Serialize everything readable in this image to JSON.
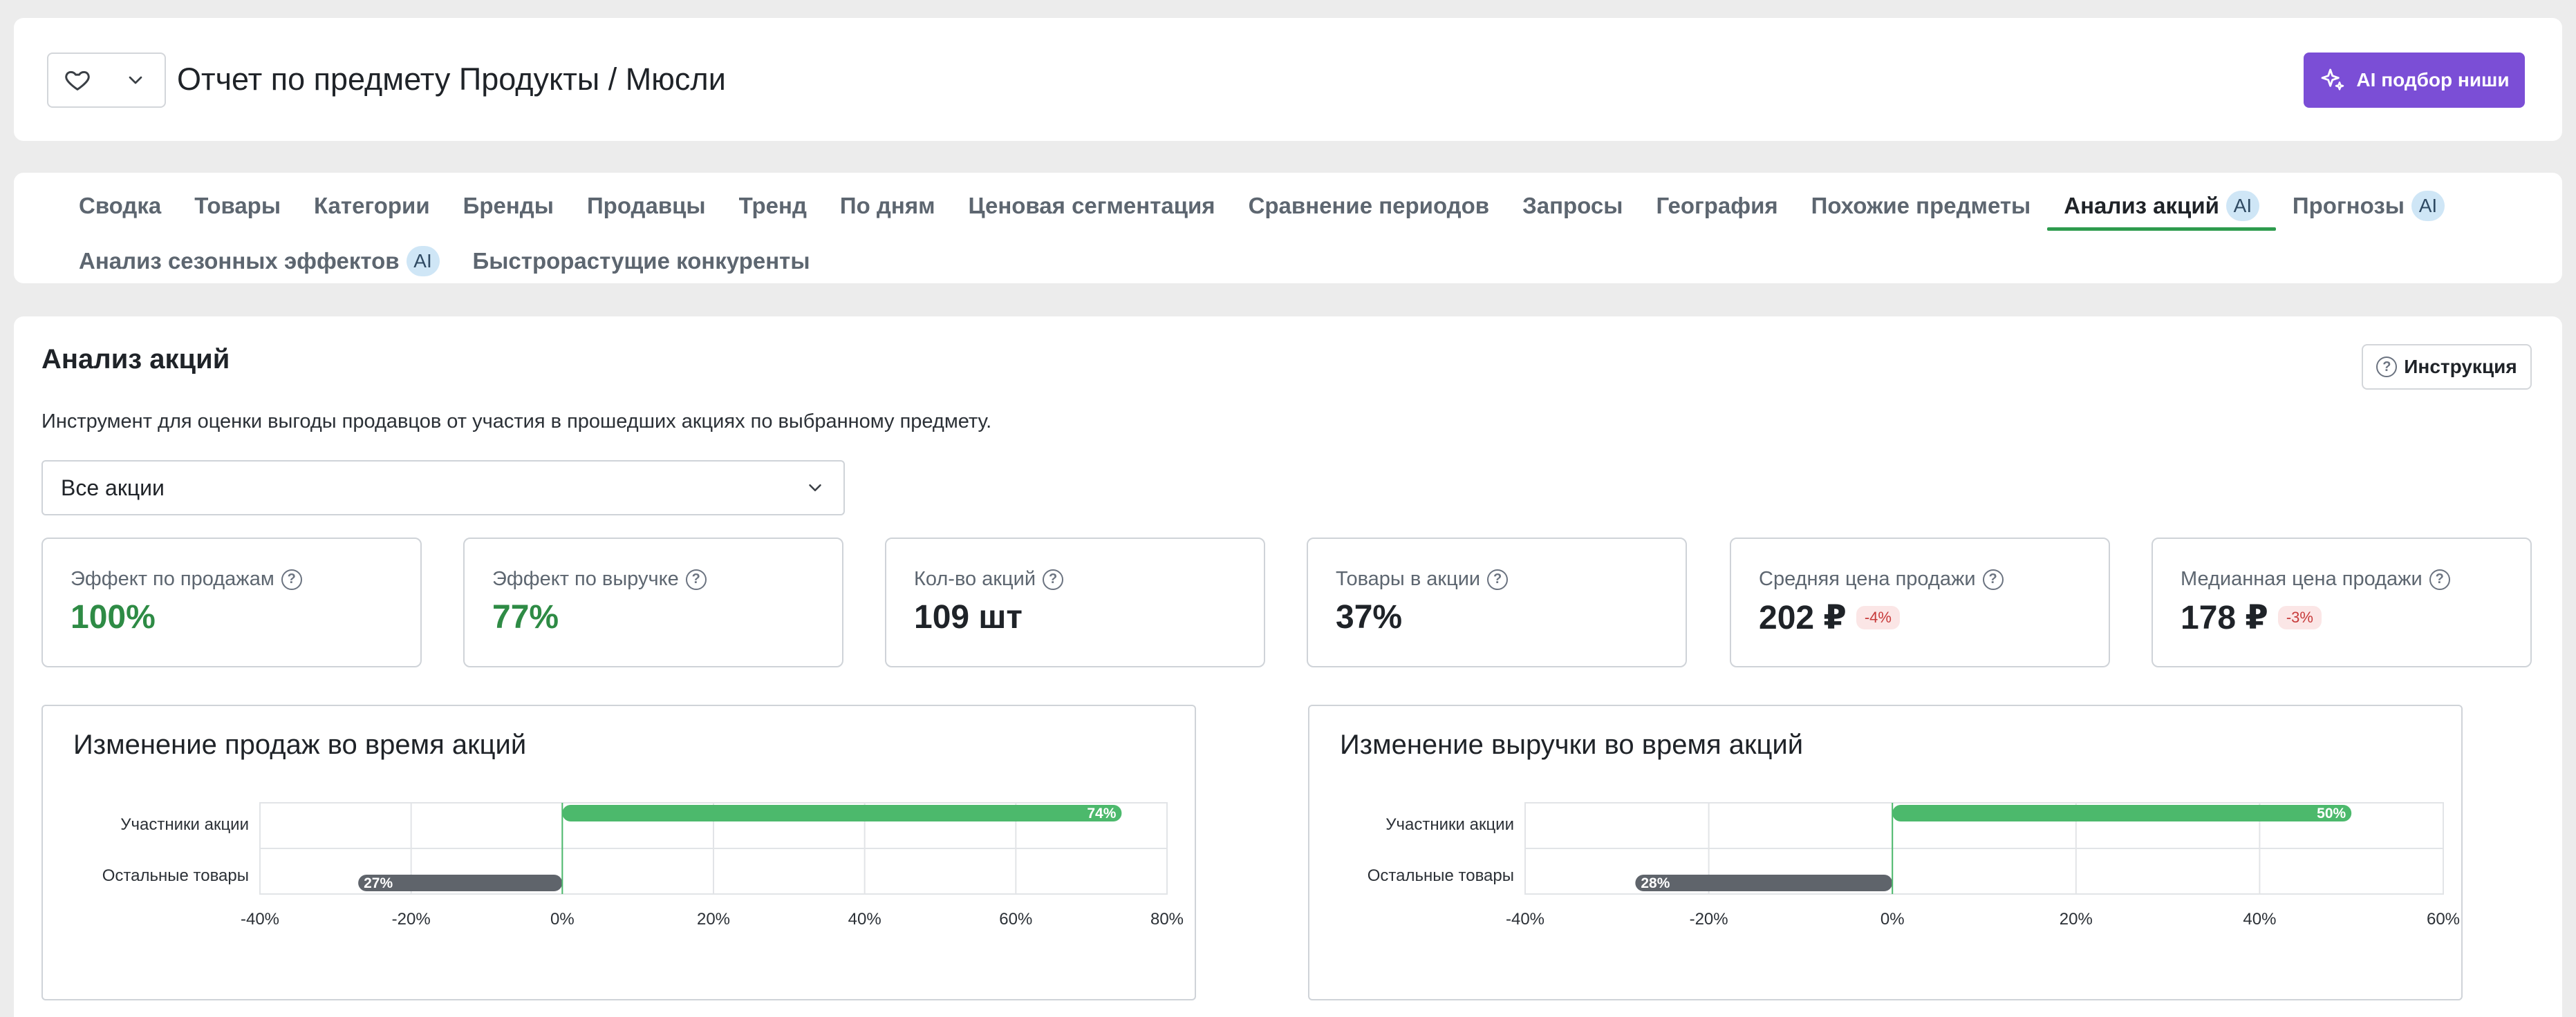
{
  "header": {
    "title": "Отчет по предмету Продукты / Мюсли",
    "ai_button": "AI подбор ниши"
  },
  "tabs": {
    "row1": [
      {
        "label": "Сводка"
      },
      {
        "label": "Товары"
      },
      {
        "label": "Категории"
      },
      {
        "label": "Бренды"
      },
      {
        "label": "Продавцы"
      },
      {
        "label": "Тренд"
      },
      {
        "label": "По дням"
      },
      {
        "label": "Ценовая сегментация"
      },
      {
        "label": "Сравнение периодов"
      },
      {
        "label": "Запросы"
      },
      {
        "label": "География"
      },
      {
        "label": "Похожие предметы"
      },
      {
        "label": "Анализ акций",
        "badge": "AI",
        "active": true
      },
      {
        "label": "Прогнозы",
        "badge": "AI"
      }
    ],
    "row2": [
      {
        "label": "Анализ сезонных эффектов",
        "badge": "AI"
      },
      {
        "label": "Быстрорастущие конкуренты"
      }
    ]
  },
  "main": {
    "title": "Анализ акций",
    "help_button": "Инструкция",
    "description": "Инструмент для оценки выгоды продавцов от участия в прошедших акциях по выбранному предмету.",
    "select_value": "Все акции",
    "kpis": [
      {
        "label": "Эффект по продажам",
        "value": "100%",
        "color": "#2e8b45"
      },
      {
        "label": "Эффект по выручке",
        "value": "77%",
        "color": "#2e8b45"
      },
      {
        "label": "Кол-во акций",
        "value": "109 шт"
      },
      {
        "label": "Товары в акции",
        "value": "37%"
      },
      {
        "label": "Средняя цена продажи",
        "value": "202 ₽",
        "delta": "-4%"
      },
      {
        "label": "Медианная цена продажи",
        "value": "178 ₽",
        "delta": "-3%"
      }
    ]
  },
  "chart_data": [
    {
      "type": "bar",
      "orientation": "horizontal",
      "title": "Изменение продаж во время акций",
      "categories": [
        "Участники акции",
        "Остальные товары"
      ],
      "values": [
        74,
        -27
      ],
      "data_labels": [
        "74%",
        "27%"
      ],
      "colors": [
        "#4cb96c",
        "#5f646b"
      ],
      "xlim": [
        -40,
        80
      ],
      "xticks": [
        -40,
        -20,
        0,
        20,
        40,
        60,
        80
      ],
      "xtick_labels": [
        "-40%",
        "-20%",
        "0%",
        "20%",
        "40%",
        "60%",
        "80%"
      ],
      "grid": true
    },
    {
      "type": "bar",
      "orientation": "horizontal",
      "title": "Изменение выручки во время акций",
      "categories": [
        "Участники акции",
        "Остальные товары"
      ],
      "values": [
        50,
        -28
      ],
      "data_labels": [
        "50%",
        "28%"
      ],
      "colors": [
        "#4cb96c",
        "#5f646b"
      ],
      "xlim": [
        -40,
        60
      ],
      "xticks": [
        -40,
        -20,
        0,
        20,
        40,
        60
      ],
      "xtick_labels": [
        "-40%",
        "-20%",
        "0%",
        "20%",
        "40%",
        "60%"
      ],
      "grid": true
    }
  ]
}
